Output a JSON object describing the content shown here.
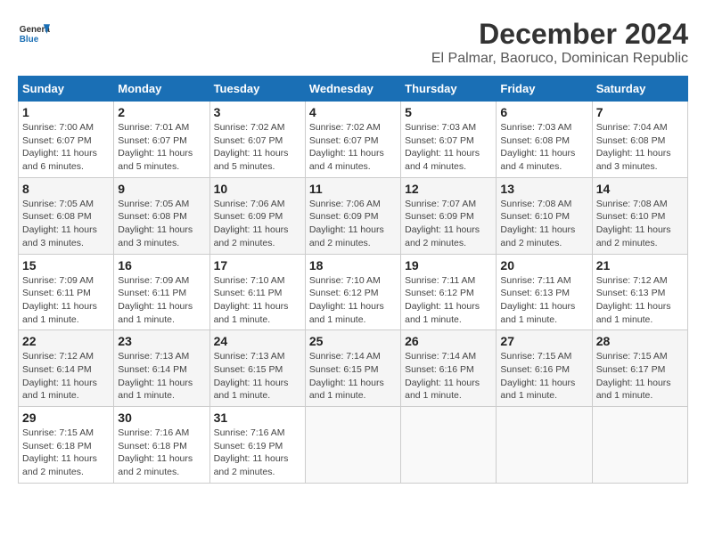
{
  "header": {
    "logo_line1": "General",
    "logo_line2": "Blue",
    "title": "December 2024",
    "subtitle": "El Palmar, Baoruco, Dominican Republic"
  },
  "weekdays": [
    "Sunday",
    "Monday",
    "Tuesday",
    "Wednesday",
    "Thursday",
    "Friday",
    "Saturday"
  ],
  "weeks": [
    [
      {
        "day": 1,
        "info": "Sunrise: 7:00 AM\nSunset: 6:07 PM\nDaylight: 11 hours\nand 6 minutes."
      },
      {
        "day": 2,
        "info": "Sunrise: 7:01 AM\nSunset: 6:07 PM\nDaylight: 11 hours\nand 5 minutes."
      },
      {
        "day": 3,
        "info": "Sunrise: 7:02 AM\nSunset: 6:07 PM\nDaylight: 11 hours\nand 5 minutes."
      },
      {
        "day": 4,
        "info": "Sunrise: 7:02 AM\nSunset: 6:07 PM\nDaylight: 11 hours\nand 4 minutes."
      },
      {
        "day": 5,
        "info": "Sunrise: 7:03 AM\nSunset: 6:07 PM\nDaylight: 11 hours\nand 4 minutes."
      },
      {
        "day": 6,
        "info": "Sunrise: 7:03 AM\nSunset: 6:08 PM\nDaylight: 11 hours\nand 4 minutes."
      },
      {
        "day": 7,
        "info": "Sunrise: 7:04 AM\nSunset: 6:08 PM\nDaylight: 11 hours\nand 3 minutes."
      }
    ],
    [
      {
        "day": 8,
        "info": "Sunrise: 7:05 AM\nSunset: 6:08 PM\nDaylight: 11 hours\nand 3 minutes."
      },
      {
        "day": 9,
        "info": "Sunrise: 7:05 AM\nSunset: 6:08 PM\nDaylight: 11 hours\nand 3 minutes."
      },
      {
        "day": 10,
        "info": "Sunrise: 7:06 AM\nSunset: 6:09 PM\nDaylight: 11 hours\nand 2 minutes."
      },
      {
        "day": 11,
        "info": "Sunrise: 7:06 AM\nSunset: 6:09 PM\nDaylight: 11 hours\nand 2 minutes."
      },
      {
        "day": 12,
        "info": "Sunrise: 7:07 AM\nSunset: 6:09 PM\nDaylight: 11 hours\nand 2 minutes."
      },
      {
        "day": 13,
        "info": "Sunrise: 7:08 AM\nSunset: 6:10 PM\nDaylight: 11 hours\nand 2 minutes."
      },
      {
        "day": 14,
        "info": "Sunrise: 7:08 AM\nSunset: 6:10 PM\nDaylight: 11 hours\nand 2 minutes."
      }
    ],
    [
      {
        "day": 15,
        "info": "Sunrise: 7:09 AM\nSunset: 6:11 PM\nDaylight: 11 hours\nand 1 minute."
      },
      {
        "day": 16,
        "info": "Sunrise: 7:09 AM\nSunset: 6:11 PM\nDaylight: 11 hours\nand 1 minute."
      },
      {
        "day": 17,
        "info": "Sunrise: 7:10 AM\nSunset: 6:11 PM\nDaylight: 11 hours\nand 1 minute."
      },
      {
        "day": 18,
        "info": "Sunrise: 7:10 AM\nSunset: 6:12 PM\nDaylight: 11 hours\nand 1 minute."
      },
      {
        "day": 19,
        "info": "Sunrise: 7:11 AM\nSunset: 6:12 PM\nDaylight: 11 hours\nand 1 minute."
      },
      {
        "day": 20,
        "info": "Sunrise: 7:11 AM\nSunset: 6:13 PM\nDaylight: 11 hours\nand 1 minute."
      },
      {
        "day": 21,
        "info": "Sunrise: 7:12 AM\nSunset: 6:13 PM\nDaylight: 11 hours\nand 1 minute."
      }
    ],
    [
      {
        "day": 22,
        "info": "Sunrise: 7:12 AM\nSunset: 6:14 PM\nDaylight: 11 hours\nand 1 minute."
      },
      {
        "day": 23,
        "info": "Sunrise: 7:13 AM\nSunset: 6:14 PM\nDaylight: 11 hours\nand 1 minute."
      },
      {
        "day": 24,
        "info": "Sunrise: 7:13 AM\nSunset: 6:15 PM\nDaylight: 11 hours\nand 1 minute."
      },
      {
        "day": 25,
        "info": "Sunrise: 7:14 AM\nSunset: 6:15 PM\nDaylight: 11 hours\nand 1 minute."
      },
      {
        "day": 26,
        "info": "Sunrise: 7:14 AM\nSunset: 6:16 PM\nDaylight: 11 hours\nand 1 minute."
      },
      {
        "day": 27,
        "info": "Sunrise: 7:15 AM\nSunset: 6:16 PM\nDaylight: 11 hours\nand 1 minute."
      },
      {
        "day": 28,
        "info": "Sunrise: 7:15 AM\nSunset: 6:17 PM\nDaylight: 11 hours\nand 1 minute."
      }
    ],
    [
      {
        "day": 29,
        "info": "Sunrise: 7:15 AM\nSunset: 6:18 PM\nDaylight: 11 hours\nand 2 minutes."
      },
      {
        "day": 30,
        "info": "Sunrise: 7:16 AM\nSunset: 6:18 PM\nDaylight: 11 hours\nand 2 minutes."
      },
      {
        "day": 31,
        "info": "Sunrise: 7:16 AM\nSunset: 6:19 PM\nDaylight: 11 hours\nand 2 minutes."
      },
      {
        "day": null,
        "info": ""
      },
      {
        "day": null,
        "info": ""
      },
      {
        "day": null,
        "info": ""
      },
      {
        "day": null,
        "info": ""
      }
    ]
  ]
}
